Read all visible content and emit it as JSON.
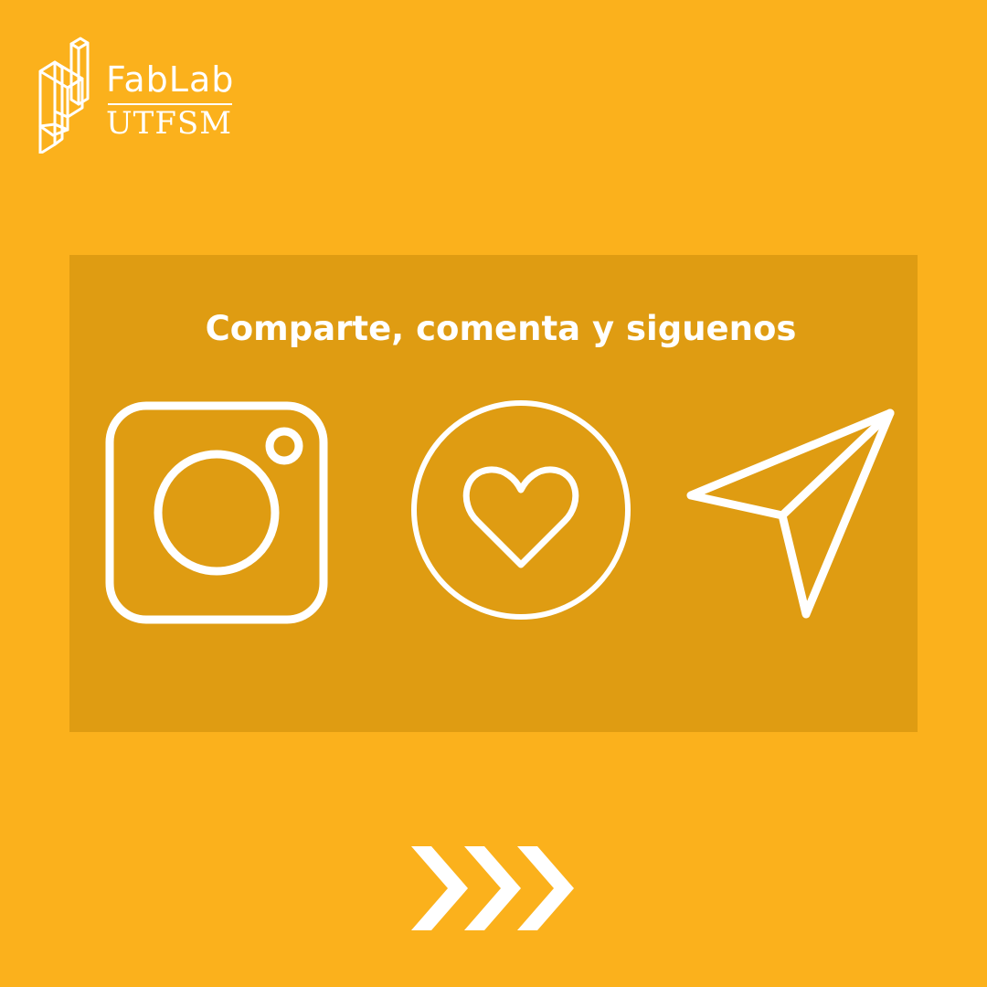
{
  "logo": {
    "line1": "FabLab",
    "line2": "UTFSM",
    "mark_icon": "fablab-cube-logo"
  },
  "main": {
    "heading": "Comparte, comenta y siguenos",
    "icons": [
      "instagram-icon",
      "heart-icon",
      "send-icon"
    ]
  },
  "footer": {
    "next_icon": "triple-chevron-right-icon"
  },
  "colors": {
    "background": "#FBB11C",
    "panel": "#DF9C12",
    "foreground": "#FFFFFF"
  }
}
